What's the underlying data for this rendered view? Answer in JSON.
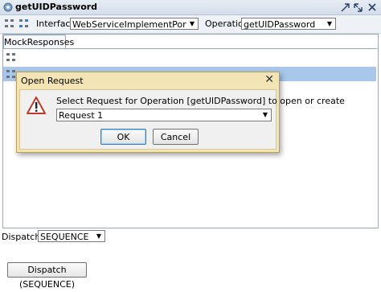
{
  "window": {
    "title": "getUIDPassword"
  },
  "toolbar": {
    "interface_label": "Interface",
    "interface_value": "WebServiceImplementPortBinding",
    "operation_label": "Operation",
    "operation_value": "getUIDPassword"
  },
  "tabs": [
    {
      "label": "MockResponses"
    }
  ],
  "dispatch": {
    "label": "Dispatch:",
    "value": "SEQUENCE",
    "button_label": "Dispatch (SEQUENCE)"
  },
  "dialog": {
    "title": "Open Request",
    "message": "Select Request for Operation [getUIDPassword] to open or create",
    "selected_request": "Request 1",
    "ok_label": "OK",
    "cancel_label": "Cancel"
  },
  "colors": {
    "dialog_frame": "#f2e4b5",
    "selection": "#a9c7ea",
    "warning_red": "#c0392b"
  }
}
